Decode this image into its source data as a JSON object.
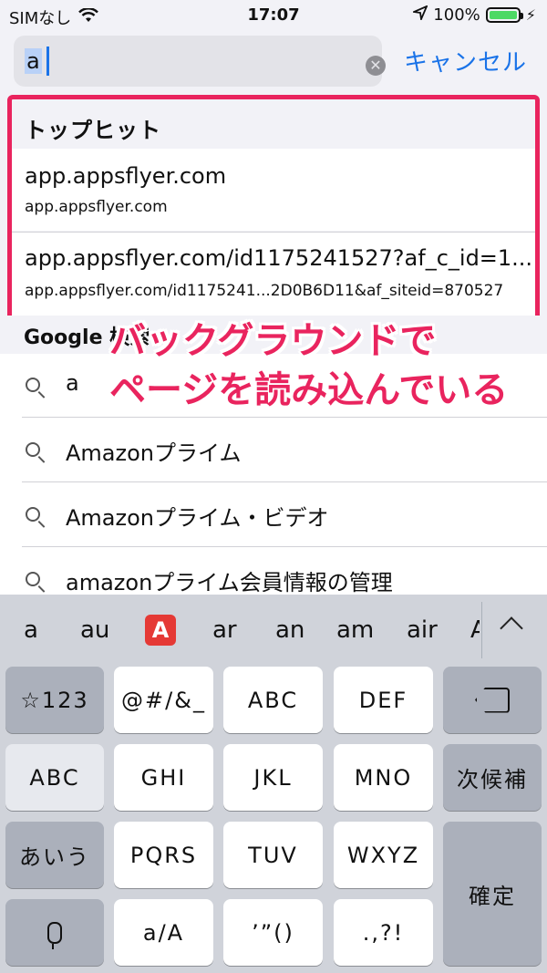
{
  "status": {
    "carrier": "SIMなし",
    "time": "17:07",
    "battery": "100%"
  },
  "search": {
    "value": "a",
    "cancel": "キャンセル"
  },
  "top_hits": {
    "header": "トップヒット",
    "items": [
      {
        "title": "app.appsflyer.com",
        "url": "app.appsflyer.com"
      },
      {
        "title": "app.appsflyer.com/id1175241527?af_c_id=1...",
        "url": "app.appsflyer.com/id1175241...2D0B6D11&af_siteid=870527"
      }
    ]
  },
  "google": {
    "label": "Google 検索"
  },
  "suggestions": [
    "a",
    "Amazonプライム",
    "Amazonプライム・ビデオ",
    "amazonプライム会員情報の管理"
  ],
  "annotation": {
    "line1": "バックグラウンドで",
    "line2": "ページを読み込んでいる"
  },
  "keyboard": {
    "predictions": [
      "a",
      "au",
      "ar",
      "an",
      "am",
      "air",
      "A"
    ],
    "emoji": "A",
    "keys": {
      "k123": "☆123",
      "symbols": "@#/&_",
      "abc": "ABC",
      "def": "DEF",
      "abc_mode": "ABC",
      "ghi": "GHI",
      "jkl": "JKL",
      "mno": "MNO",
      "next": "次候補",
      "kana": "あいう",
      "pqrs": "PQRS",
      "tuv": "TUV",
      "wxyz": "WXYZ",
      "confirm": "確定",
      "case": "a/A",
      "quotes": "’”()",
      "punct": ".,?!"
    }
  }
}
